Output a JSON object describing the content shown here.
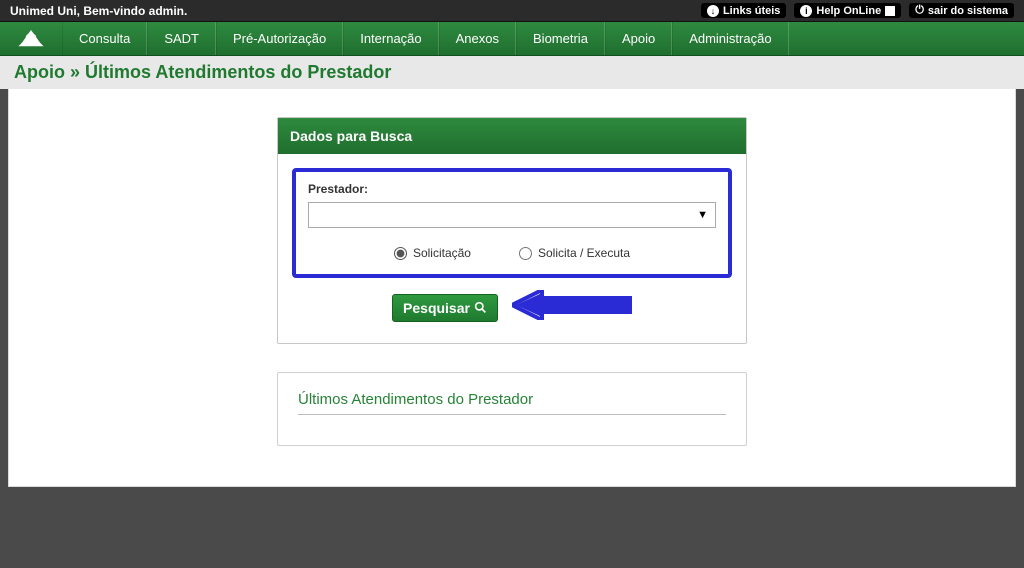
{
  "topbar": {
    "welcome": "Unimed Uni, Bem-vindo admin.",
    "links": {
      "useful": "Links úteis",
      "help": "Help OnLine",
      "logout": "sair do sistema"
    }
  },
  "nav": {
    "items": [
      "Consulta",
      "SADT",
      "Pré-Autorização",
      "Internação",
      "Anexos",
      "Biometria",
      "Apoio",
      "Administração"
    ]
  },
  "breadcrumb": "Apoio » Últimos Atendimentos do Prestador",
  "search_panel": {
    "title": "Dados para Busca",
    "field_label": "Prestador:",
    "select_value": "",
    "radio1": "Solicitação",
    "radio2": "Solicita / Executa",
    "radio_selected": "solicitacao",
    "button": "Pesquisar"
  },
  "results_panel": {
    "title": "Últimos Atendimentos do Prestador"
  }
}
